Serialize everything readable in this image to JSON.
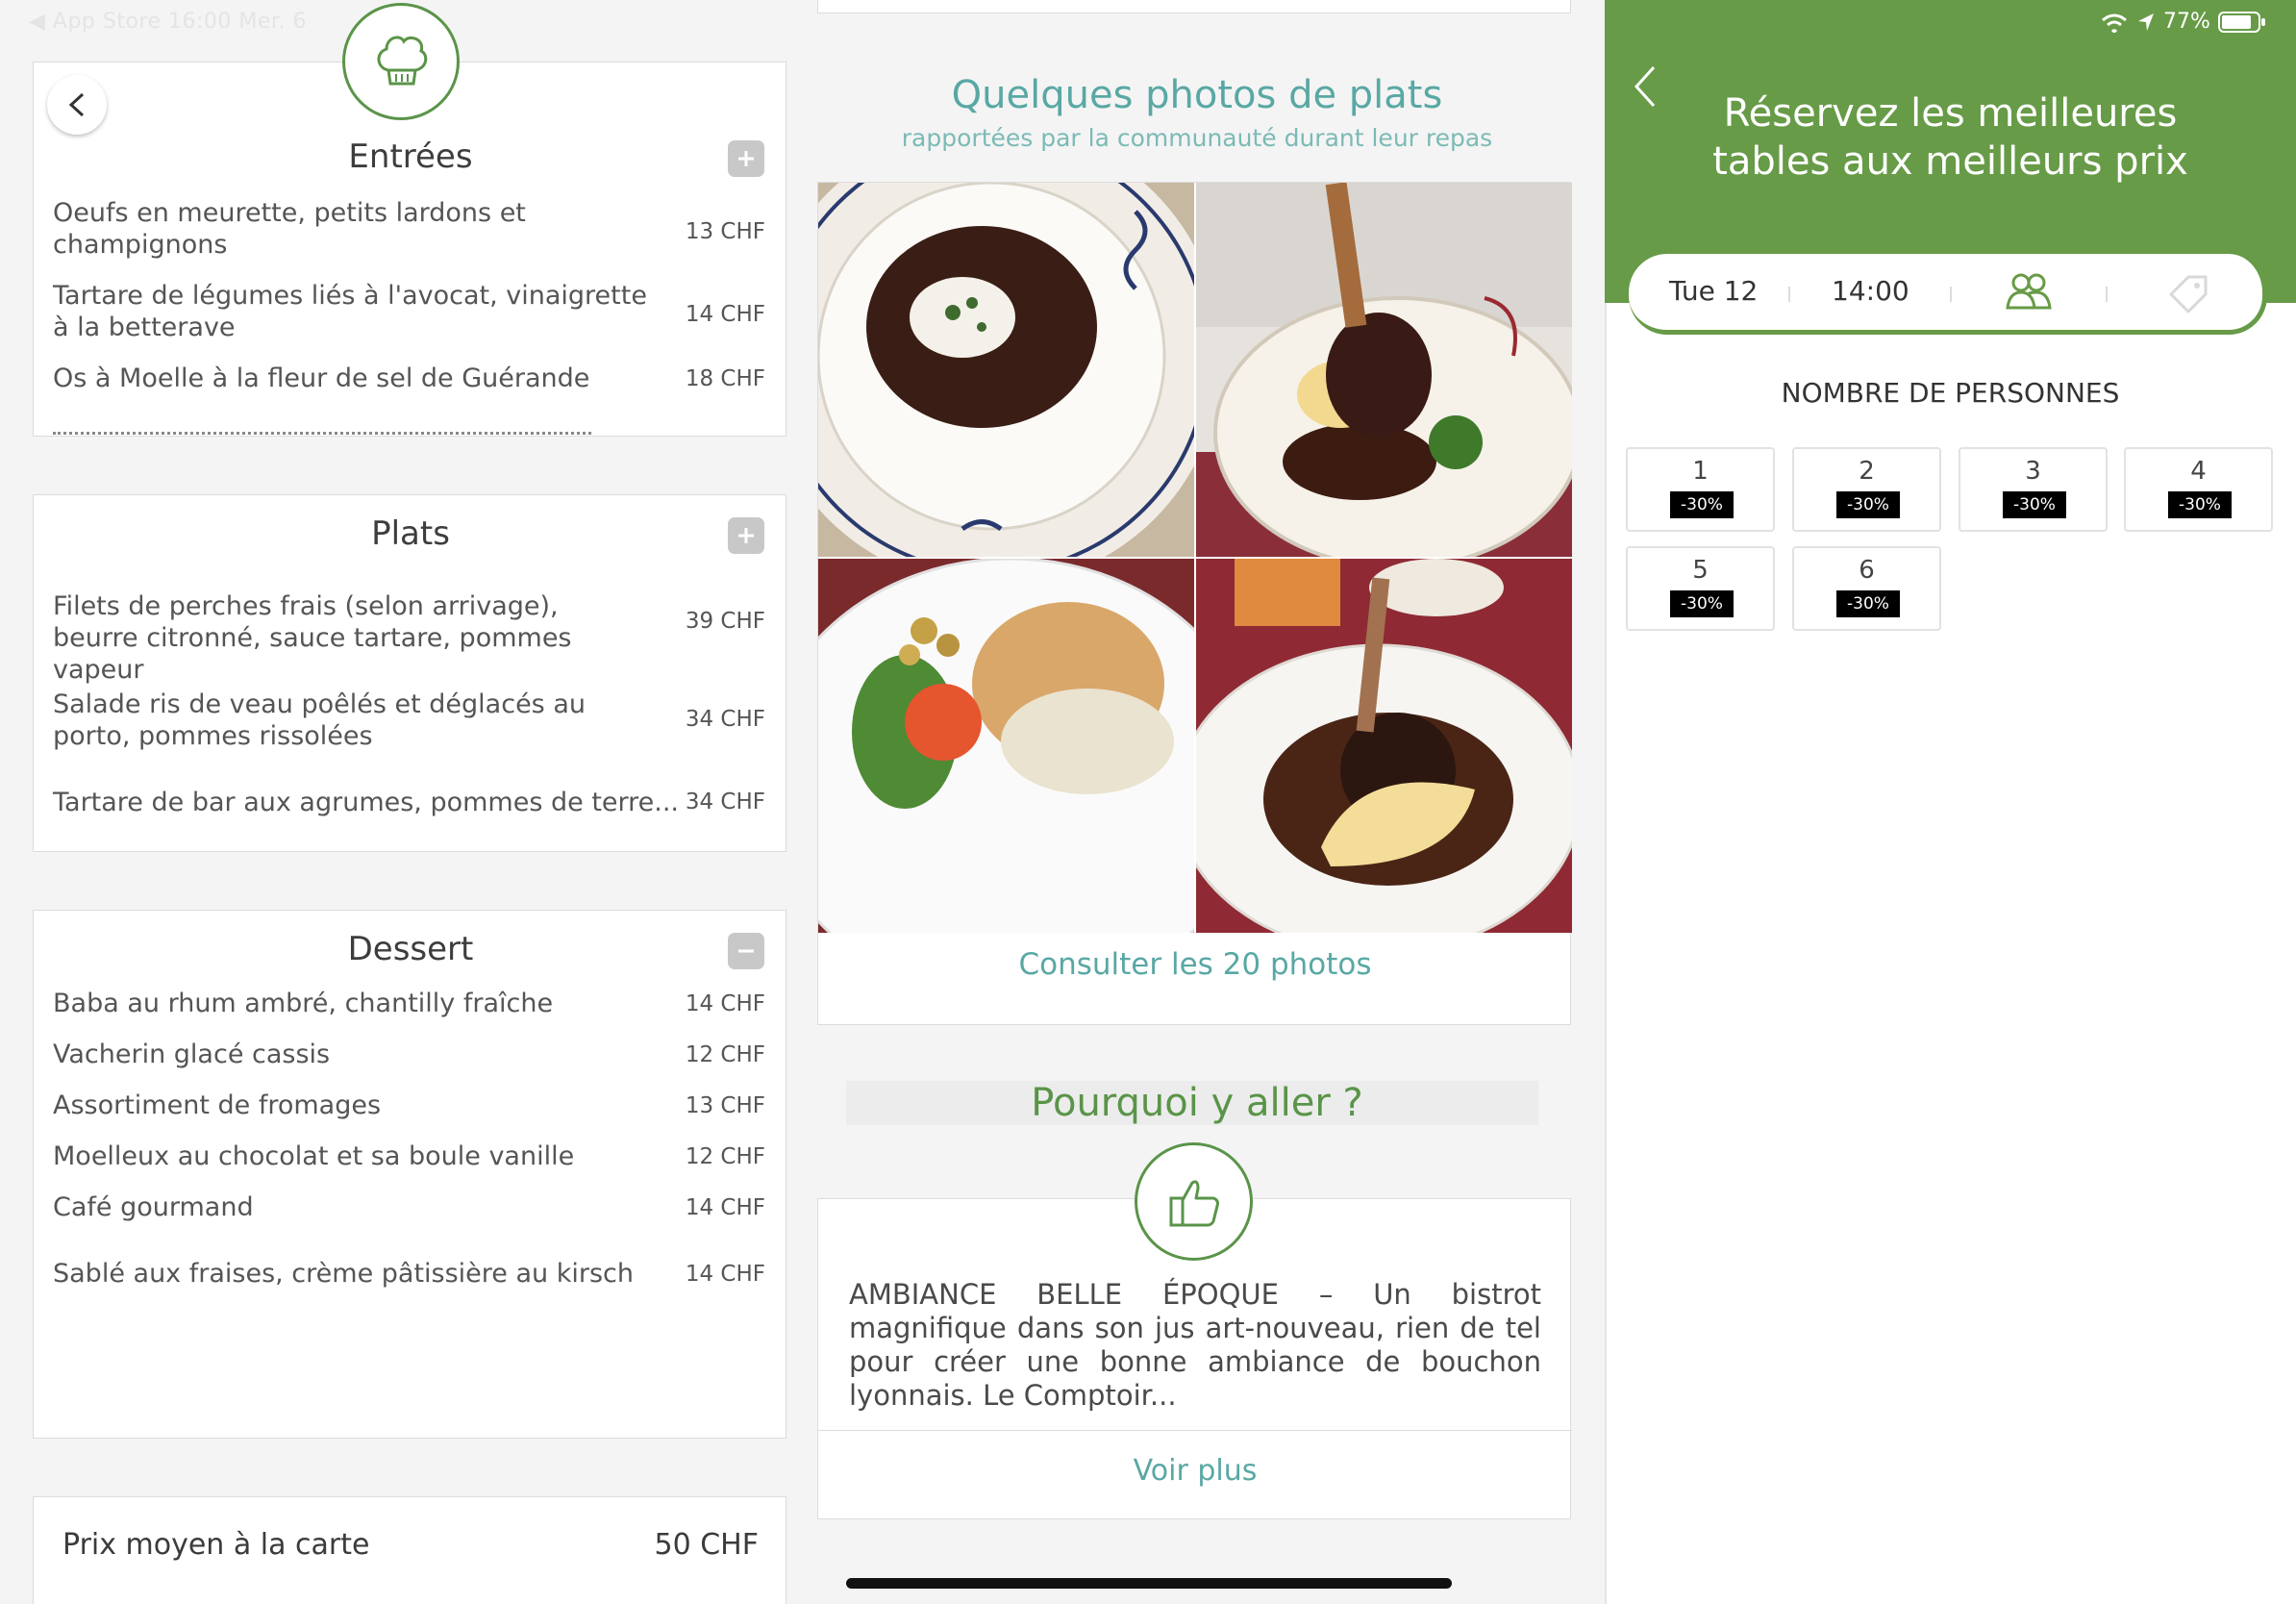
{
  "status_left": {
    "text": "◀ App Store   16:00   Mer. 6"
  },
  "status_right": {
    "battery": "77%"
  },
  "menu": {
    "entrees": {
      "title": "Entrées",
      "items": [
        {
          "name": "Oeufs en meurette, petits lardons et champignons",
          "price": "13 CHF"
        },
        {
          "name": "Tartare de légumes liés à l'avocat, vinaigrette à la betterave",
          "price": "14 CHF"
        },
        {
          "name": "Os à Moelle à la fleur de sel de Guérande",
          "price": "18 CHF"
        }
      ]
    },
    "plats": {
      "title": "Plats",
      "items": [
        {
          "name": "Filets de perches frais (selon arrivage), beurre citronné, sauce tartare, pommes vapeur",
          "price": "39 CHF"
        },
        {
          "name": "Salade ris de veau poêlés et déglacés au porto, pommes rissolées",
          "price": "34 CHF"
        },
        {
          "name": "Tartare de bar aux agrumes, pommes de terre...",
          "price": "34 CHF"
        }
      ]
    },
    "dessert": {
      "title": "Dessert",
      "items": [
        {
          "name": "Baba au rhum ambré, chantilly fraîche",
          "price": "14 CHF"
        },
        {
          "name": "Vacherin glacé cassis",
          "price": "12 CHF"
        },
        {
          "name": "Assortiment de fromages",
          "price": "13 CHF"
        },
        {
          "name": "Moelleux au chocolat et sa boule vanille",
          "price": "12 CHF"
        },
        {
          "name": "Café gourmand",
          "price": "14 CHF"
        },
        {
          "name": "Sablé aux fraises, crème pâtissière au kirsch",
          "price": "14 CHF"
        }
      ]
    },
    "average": {
      "label": "Prix moyen à la carte",
      "value": "50 CHF"
    }
  },
  "photos": {
    "title": "Quelques photos de plats",
    "subtitle": "rapportées par la communauté durant leur repas",
    "link": "Consulter les 20 photos"
  },
  "why": {
    "title": "Pourquoi y aller ?",
    "text": "AMBIANCE BELLE ÉPOQUE – Un bistrot magnifique dans son jus art-nouveau, rien de tel pour créer une bonne ambiance de bouchon lyonnais. Le Comptoir...",
    "more": "Voir plus"
  },
  "booking": {
    "title_line1": "Réservez les meilleures",
    "title_line2": "tables aux meilleurs prix",
    "date": "Tue 12",
    "time": "14:00",
    "section_title": "NOMBRE DE PERSONNES",
    "people": [
      {
        "num": "1",
        "discount": "-30%"
      },
      {
        "num": "2",
        "discount": "-30%"
      },
      {
        "num": "3",
        "discount": "-30%"
      },
      {
        "num": "4",
        "discount": "-30%"
      },
      {
        "num": "5",
        "discount": "-30%"
      },
      {
        "num": "6",
        "discount": "-30%"
      }
    ]
  },
  "colors": {
    "green": "#679b47",
    "teal": "#59a8a4"
  }
}
